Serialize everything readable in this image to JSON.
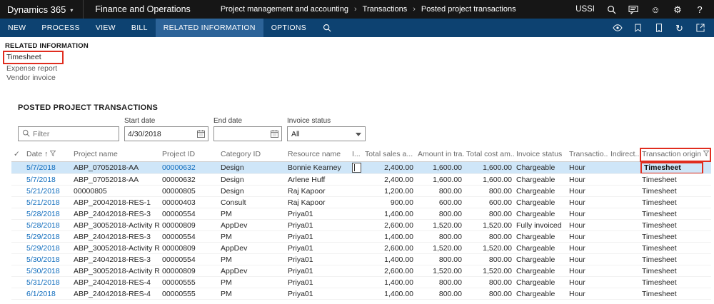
{
  "topbar": {
    "app_name": "Dynamics 365",
    "module_name": "Finance and Operations",
    "breadcrumb": [
      "Project management and accounting",
      "Transactions",
      "Posted project transactions"
    ],
    "company": "USSI"
  },
  "menubar": {
    "items": [
      "NEW",
      "PROCESS",
      "VIEW",
      "BILL",
      "RELATED INFORMATION",
      "OPTIONS"
    ],
    "active_item": "RELATED INFORMATION"
  },
  "related_info": {
    "title": "RELATED INFORMATION",
    "items": [
      {
        "label": "Timesheet",
        "boxed": true
      },
      {
        "label": "Expense report"
      },
      {
        "label": "Vendor invoice"
      }
    ]
  },
  "page": {
    "title": "POSTED PROJECT TRANSACTIONS"
  },
  "filters": {
    "filter_placeholder": "Filter",
    "start_date": {
      "label": "Start date",
      "value": "4/30/2018"
    },
    "end_date": {
      "label": "End date",
      "value": ""
    },
    "invoice_status": {
      "label": "Invoice status",
      "value": "All"
    }
  },
  "icons": {
    "chevron_down": "▾",
    "breadcrumb_sep": "›",
    "smiley": "☺",
    "gear": "⚙",
    "help": "?",
    "refresh": "↻",
    "sort_asc": "↑"
  },
  "colors": {
    "topbar": "#161616",
    "action_pane": "#0d4271",
    "active_tab": "#2c6398",
    "link": "#0f6cbd",
    "selected_row": "#cfe6f8",
    "annotation": "#e02d1f"
  },
  "table": {
    "columns": [
      {
        "label": "✓"
      },
      {
        "label": "Date",
        "sort": "asc",
        "filter": true
      },
      {
        "label": "Project name"
      },
      {
        "label": "Project ID"
      },
      {
        "label": "Category ID"
      },
      {
        "label": "Resource name"
      },
      {
        "label": "I..."
      },
      {
        "label": "Total sales a..."
      },
      {
        "label": "Amount in tra..."
      },
      {
        "label": "Total cost am..."
      },
      {
        "label": "Invoice status"
      },
      {
        "label": "Transactio..."
      },
      {
        "label": "Indirect..."
      },
      {
        "label": "Transaction origin",
        "filter": true,
        "boxed": true
      }
    ],
    "row_keys": [
      "check",
      "date",
      "project_name",
      "project_id",
      "category_id",
      "resource_name",
      "line",
      "total_sales",
      "amount_in_transaction",
      "total_cost",
      "invoice_status",
      "transaction_type",
      "indirect",
      "transaction_origin"
    ],
    "rows": [
      {
        "date": "5/7/2018",
        "project_name": "ABP_07052018-AA",
        "project_id": "00000632",
        "category_id": "Design",
        "resource_name": "Bonnie Kearney",
        "total_sales": "2,400.00",
        "amount_in_transaction": "1,600.00",
        "total_cost": "1,600.00",
        "invoice_status": "Chargeable",
        "transaction_type": "Hour",
        "transaction_origin": "Timesheet",
        "selected": true,
        "project_id_link": true,
        "line_input": true,
        "origin_boxed": true
      },
      {
        "date": "5/7/2018",
        "project_name": "ABP_07052018-AA",
        "project_id": "00000632",
        "category_id": "Design",
        "resource_name": "Arlene Huff",
        "total_sales": "2,400.00",
        "amount_in_transaction": "1,600.00",
        "total_cost": "1,600.00",
        "invoice_status": "Chargeable",
        "transaction_type": "Hour",
        "transaction_origin": "Timesheet"
      },
      {
        "date": "5/21/2018",
        "project_name": "00000805",
        "project_id": "00000805",
        "category_id": "Design",
        "resource_name": "Raj Kapoor",
        "total_sales": "1,200.00",
        "amount_in_transaction": "800.00",
        "total_cost": "800.00",
        "invoice_status": "Chargeable",
        "transaction_type": "Hour",
        "transaction_origin": "Timesheet"
      },
      {
        "date": "5/21/2018",
        "project_name": "ABP_20042018-RES-1",
        "project_id": "00000403",
        "category_id": "Consult",
        "resource_name": "Raj Kapoor",
        "total_sales": "900.00",
        "amount_in_transaction": "600.00",
        "total_cost": "600.00",
        "invoice_status": "Chargeable",
        "transaction_type": "Hour",
        "transaction_origin": "Timesheet"
      },
      {
        "date": "5/28/2018",
        "project_name": "ABP_24042018-RES-3",
        "project_id": "00000554",
        "category_id": "PM",
        "resource_name": "Priya01",
        "total_sales": "1,400.00",
        "amount_in_transaction": "800.00",
        "total_cost": "800.00",
        "invoice_status": "Chargeable",
        "transaction_type": "Hour",
        "transaction_origin": "Timesheet"
      },
      {
        "date": "5/28/2018",
        "project_name": "ABP_30052018-Activity R...",
        "project_id": "00000809",
        "category_id": "AppDev",
        "resource_name": "Priya01",
        "total_sales": "2,600.00",
        "amount_in_transaction": "1,520.00",
        "total_cost": "1,520.00",
        "invoice_status": "Fully invoiced",
        "transaction_type": "Hour",
        "transaction_origin": "Timesheet"
      },
      {
        "date": "5/29/2018",
        "project_name": "ABP_24042018-RES-3",
        "project_id": "00000554",
        "category_id": "PM",
        "resource_name": "Priya01",
        "total_sales": "1,400.00",
        "amount_in_transaction": "800.00",
        "total_cost": "800.00",
        "invoice_status": "Chargeable",
        "transaction_type": "Hour",
        "transaction_origin": "Timesheet"
      },
      {
        "date": "5/29/2018",
        "project_name": "ABP_30052018-Activity R...",
        "project_id": "00000809",
        "category_id": "AppDev",
        "resource_name": "Priya01",
        "total_sales": "2,600.00",
        "amount_in_transaction": "1,520.00",
        "total_cost": "1,520.00",
        "invoice_status": "Chargeable",
        "transaction_type": "Hour",
        "transaction_origin": "Timesheet"
      },
      {
        "date": "5/30/2018",
        "project_name": "ABP_24042018-RES-3",
        "project_id": "00000554",
        "category_id": "PM",
        "resource_name": "Priya01",
        "total_sales": "1,400.00",
        "amount_in_transaction": "800.00",
        "total_cost": "800.00",
        "invoice_status": "Chargeable",
        "transaction_type": "Hour",
        "transaction_origin": "Timesheet"
      },
      {
        "date": "5/30/2018",
        "project_name": "ABP_30052018-Activity R...",
        "project_id": "00000809",
        "category_id": "AppDev",
        "resource_name": "Priya01",
        "total_sales": "2,600.00",
        "amount_in_transaction": "1,520.00",
        "total_cost": "1,520.00",
        "invoice_status": "Chargeable",
        "transaction_type": "Hour",
        "transaction_origin": "Timesheet"
      },
      {
        "date": "5/31/2018",
        "project_name": "ABP_24042018-RES-4",
        "project_id": "00000555",
        "category_id": "PM",
        "resource_name": "Priya01",
        "total_sales": "1,400.00",
        "amount_in_transaction": "800.00",
        "total_cost": "800.00",
        "invoice_status": "Chargeable",
        "transaction_type": "Hour",
        "transaction_origin": "Timesheet"
      },
      {
        "date": "6/1/2018",
        "project_name": "ABP_24042018-RES-4",
        "project_id": "00000555",
        "category_id": "PM",
        "resource_name": "Priya01",
        "total_sales": "1,400.00",
        "amount_in_transaction": "800.00",
        "total_cost": "800.00",
        "invoice_status": "Chargeable",
        "transaction_type": "Hour",
        "transaction_origin": "Timesheet"
      }
    ]
  }
}
